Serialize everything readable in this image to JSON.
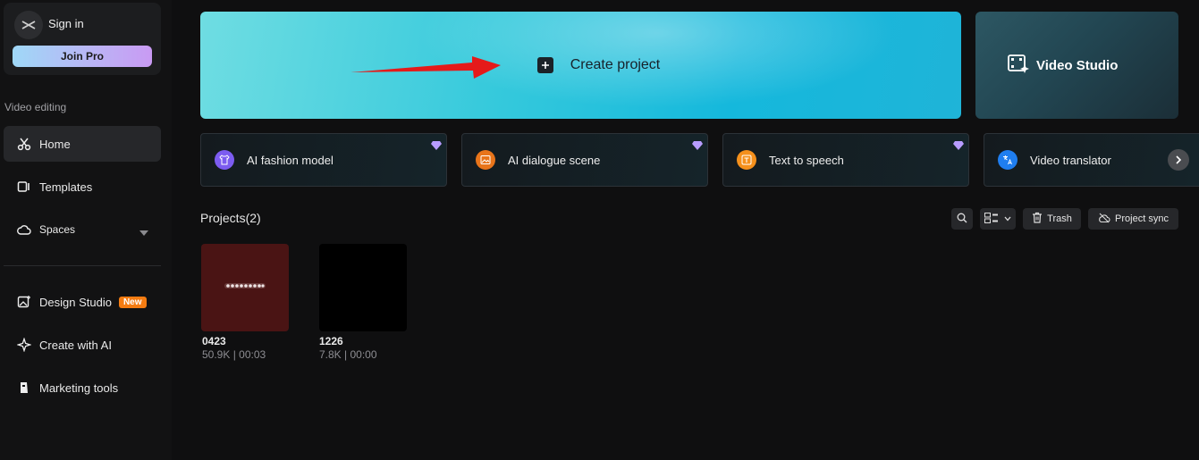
{
  "account": {
    "signin_label": "Sign in",
    "join_pro_label": "Join Pro"
  },
  "sidebar": {
    "section_label": "Video editing",
    "items": [
      {
        "label": "Home",
        "icon": "scissors-icon",
        "active": true
      },
      {
        "label": "Templates",
        "icon": "templates-icon"
      },
      {
        "label": "Spaces",
        "icon": "cloud-icon"
      },
      {
        "label": "Design Studio",
        "icon": "design-icon",
        "badge": "New"
      },
      {
        "label": "Create with AI",
        "icon": "sparkle-icon"
      },
      {
        "label": "Marketing tools",
        "icon": "marketing-icon"
      }
    ]
  },
  "hero": {
    "create_label": "Create project",
    "video_studio_label": "Video Studio"
  },
  "features": [
    {
      "label": "AI fashion model",
      "icon": "shirt-icon",
      "color": "#7c5cf0",
      "pro": true
    },
    {
      "label": "AI dialogue scene",
      "icon": "image-icon",
      "color": "#e8741a",
      "pro": true
    },
    {
      "label": "Text to speech",
      "icon": "tts-icon",
      "color": "#f5901c",
      "pro": true
    },
    {
      "label": "Video translator",
      "icon": "translate-icon",
      "color": "#1f7ef0",
      "pro": false
    }
  ],
  "projects": {
    "title": "Projects(2)",
    "trash_label": "Trash",
    "sync_label": "Project sync",
    "items": [
      {
        "name": "0423",
        "meta": "50.9K | 00:03",
        "thumb_color": "#4a1414"
      },
      {
        "name": "1226",
        "meta": "7.8K | 00:00",
        "thumb_color": "#000000"
      }
    ]
  },
  "colors": {
    "background": "#0f0f10",
    "accent_hero": "#15b8dc",
    "badge_new": "#f57c12",
    "pro_diamond": "#b89cff"
  }
}
